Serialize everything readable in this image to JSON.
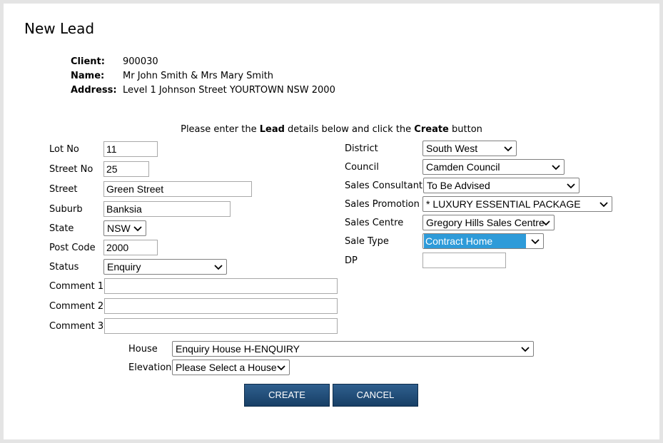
{
  "page": {
    "title": "New Lead"
  },
  "client": {
    "client_label": "Client:",
    "client_value": "900030",
    "name_label": "Name:",
    "name_value": "Mr John Smith & Mrs Mary Smith",
    "address_label": "Address:",
    "address_value": "Level 1 Johnson Street YOURTOWN NSW 2000"
  },
  "instructions": {
    "part1": "Please enter the ",
    "bold1": "Lead",
    "part2": " details below and click the ",
    "bold2": "Create",
    "part3": " button"
  },
  "left": {
    "lot_no": {
      "label": "Lot No",
      "value": "11"
    },
    "street_no": {
      "label": "Street No",
      "value": "25"
    },
    "street": {
      "label": "Street",
      "value": "Green Street"
    },
    "suburb": {
      "label": "Suburb",
      "value": "Banksia"
    },
    "state": {
      "label": "State",
      "value": "NSW"
    },
    "post_code": {
      "label": "Post Code",
      "value": "2000"
    },
    "status": {
      "label": "Status",
      "value": "Enquiry"
    },
    "comment1": {
      "label": "Comment 1",
      "value": ""
    },
    "comment2": {
      "label": "Comment 2",
      "value": ""
    },
    "comment3": {
      "label": "Comment 3",
      "value": ""
    }
  },
  "right": {
    "district": {
      "label": "District",
      "value": "South West"
    },
    "council": {
      "label": "Council",
      "value": "Camden Council"
    },
    "sales_consultant": {
      "label": "Sales Consultant",
      "value": "To Be Advised"
    },
    "sales_promotion": {
      "label": "Sales Promotion",
      "value": "* LUXURY ESSENTIAL PACKAGE"
    },
    "sales_centre": {
      "label": "Sales Centre",
      "value": "Gregory Hills Sales Centre"
    },
    "sale_type": {
      "label": "Sale Type",
      "value": "Contract Home"
    },
    "dp": {
      "label": "DP",
      "value": ""
    }
  },
  "house": {
    "house_label": "House",
    "house_value": "Enquiry House H-ENQUIRY",
    "elevation_label": "Elevation",
    "elevation_value": "Please Select a House"
  },
  "buttons": {
    "create": "CREATE",
    "cancel": "CANCEL"
  },
  "colors": {
    "button": "#1f4a75",
    "selection": "#2e9bd9"
  },
  "icons": {
    "dropdown": "chevron-down-icon"
  }
}
